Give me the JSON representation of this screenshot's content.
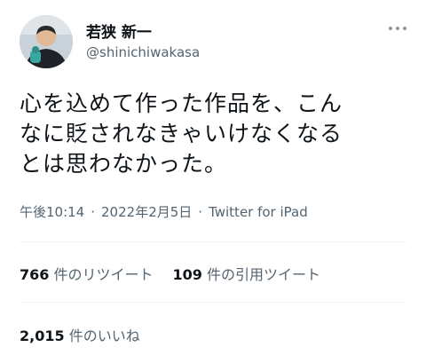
{
  "user": {
    "display_name": "若狭 新一",
    "handle": "@shinichiwakasa",
    "avatar_icon": "profile-photo"
  },
  "tweet": {
    "lines": [
      "心を込めて作った作品を、こん",
      "なに貶されなきゃいけなくなる",
      "とは思わなかった。"
    ],
    "time": "午後10:14",
    "date": "2022年2月5日",
    "separator": "·",
    "source": "Twitter for iPad"
  },
  "stats": {
    "retweets_count": "766",
    "retweets_label": "件のリツイート",
    "quotes_count": "109",
    "quotes_label": "件の引用ツイート",
    "likes_count": "2,015",
    "likes_label": "件のいいね"
  },
  "colors": {
    "text": "#0f1419",
    "secondary": "#536471",
    "divider": "#eff3f4"
  }
}
